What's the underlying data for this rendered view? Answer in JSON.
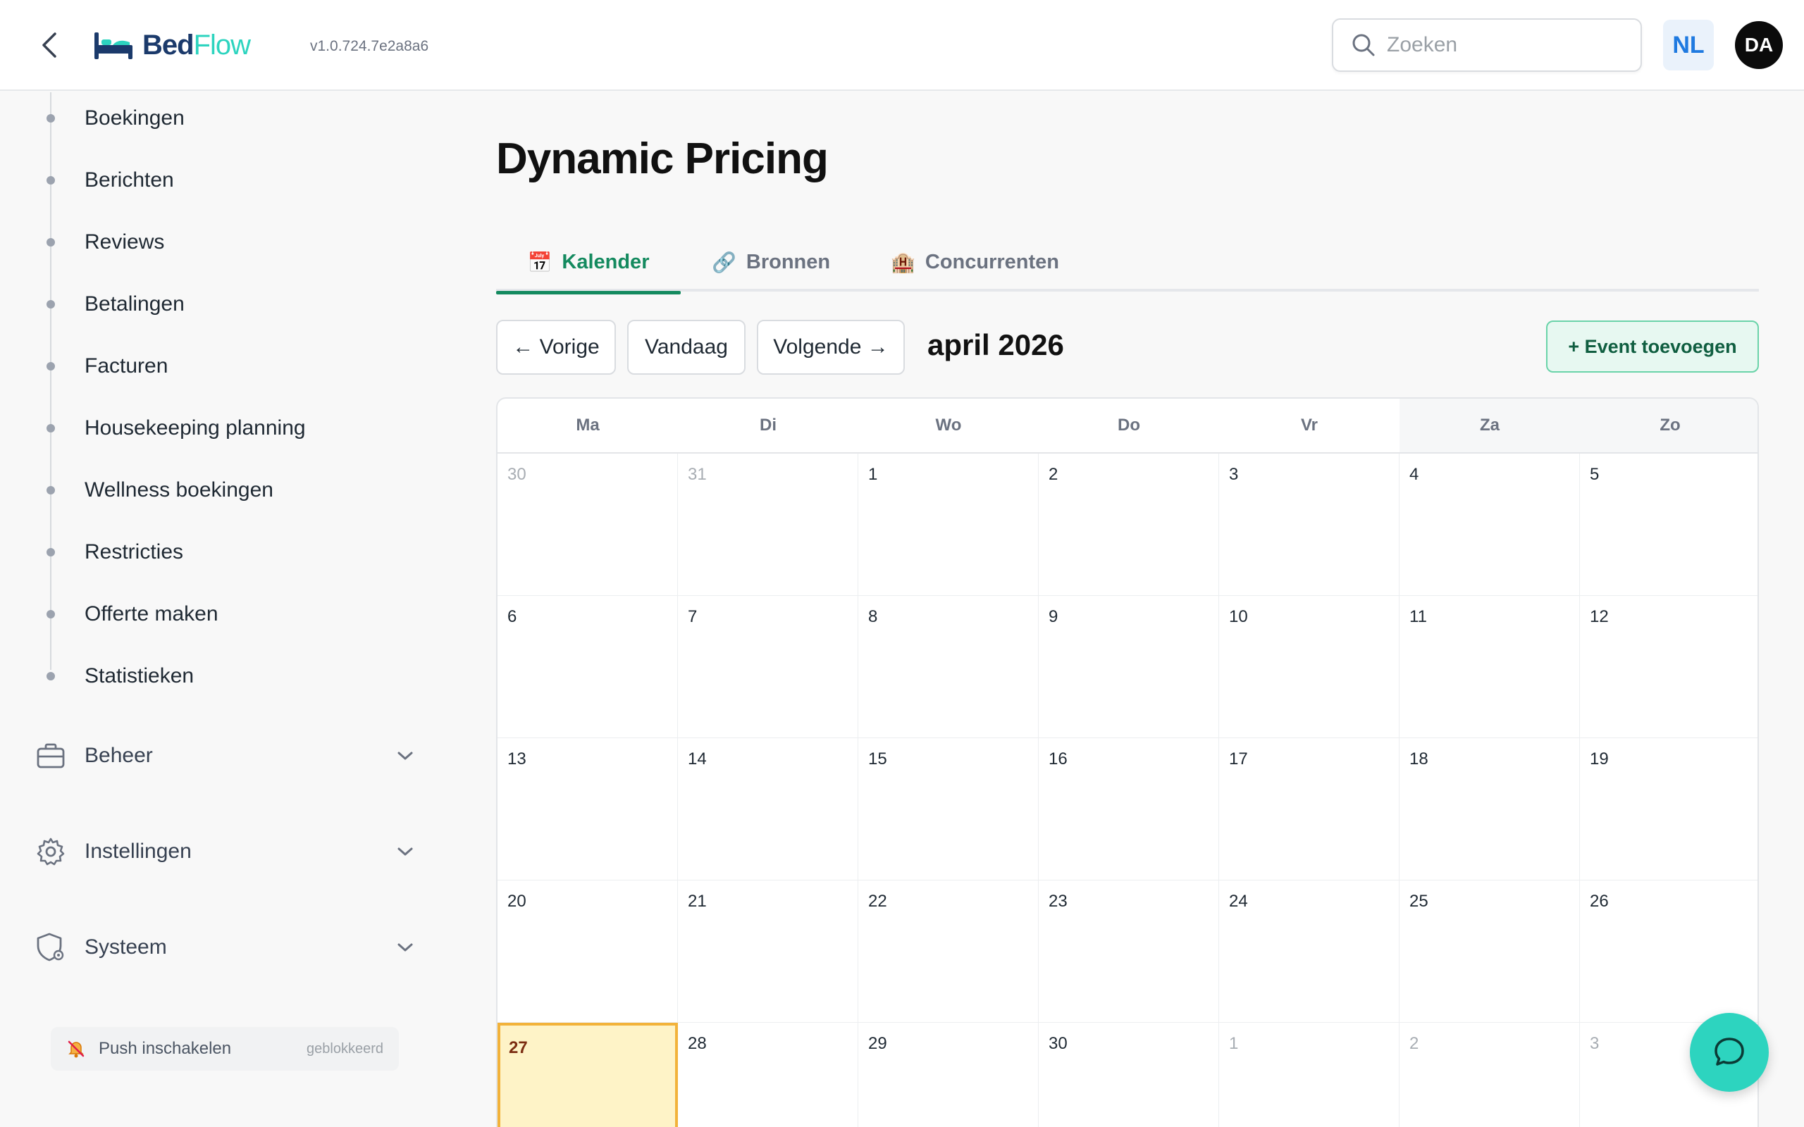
{
  "header": {
    "logo_bed": "Bed",
    "logo_flow": "Flow",
    "version": "v1.0.724.7e2a8a6",
    "search_placeholder": "Zoeken",
    "language": "NL",
    "user_initials": "DA"
  },
  "sidebar": {
    "sub_items": [
      {
        "label": "Boekingen"
      },
      {
        "label": "Berichten"
      },
      {
        "label": "Reviews"
      },
      {
        "label": "Betalingen"
      },
      {
        "label": "Facturen"
      },
      {
        "label": "Housekeeping planning"
      },
      {
        "label": "Wellness boekingen"
      },
      {
        "label": "Restricties"
      },
      {
        "label": "Offerte maken"
      },
      {
        "label": "Statistieken"
      }
    ],
    "groups": [
      {
        "label": "Beheer",
        "icon": "briefcase-icon"
      },
      {
        "label": "Instellingen",
        "icon": "gear-icon"
      },
      {
        "label": "Systeem",
        "icon": "shield-gear-icon"
      }
    ],
    "push": {
      "label": "Push inschakelen",
      "status": "geblokkeerd",
      "icon": "bell-off-icon"
    }
  },
  "main": {
    "title": "Dynamic Pricing",
    "tabs": [
      {
        "label": "Kalender",
        "icon": "📅",
        "active": true
      },
      {
        "label": "Bronnen",
        "icon": "🔗",
        "active": false
      },
      {
        "label": "Concurrenten",
        "icon": "🏨",
        "active": false
      }
    ],
    "toolbar": {
      "prev_label": "← Vorige",
      "today_label": "Vandaag",
      "next_label": "Volgende →",
      "month_label": "april 2026",
      "add_event_label": "+ Event toevoegen"
    },
    "calendar": {
      "weekdays": [
        "Ma",
        "Di",
        "Wo",
        "Do",
        "Vr",
        "Za",
        "Zo"
      ],
      "weeks": [
        [
          {
            "day": "30",
            "out": true
          },
          {
            "day": "31",
            "out": true
          },
          {
            "day": "1"
          },
          {
            "day": "2"
          },
          {
            "day": "3"
          },
          {
            "day": "4"
          },
          {
            "day": "5"
          }
        ],
        [
          {
            "day": "6"
          },
          {
            "day": "7"
          },
          {
            "day": "8"
          },
          {
            "day": "9"
          },
          {
            "day": "10"
          },
          {
            "day": "11"
          },
          {
            "day": "12"
          }
        ],
        [
          {
            "day": "13"
          },
          {
            "day": "14"
          },
          {
            "day": "15"
          },
          {
            "day": "16"
          },
          {
            "day": "17"
          },
          {
            "day": "18"
          },
          {
            "day": "19"
          }
        ],
        [
          {
            "day": "20"
          },
          {
            "day": "21"
          },
          {
            "day": "22"
          },
          {
            "day": "23"
          },
          {
            "day": "24"
          },
          {
            "day": "25"
          },
          {
            "day": "26"
          }
        ],
        [
          {
            "day": "27",
            "today": true
          },
          {
            "day": "28"
          },
          {
            "day": "29"
          },
          {
            "day": "30"
          },
          {
            "day": "1",
            "out": true
          },
          {
            "day": "2",
            "out": true
          },
          {
            "day": "3",
            "out": true
          }
        ]
      ]
    }
  },
  "colors": {
    "accent_green": "#148a5f",
    "brand_teal": "#2dd4bf",
    "brand_navy": "#1b3a6b",
    "today_bg": "#fef3c7",
    "today_border": "#f2b23a"
  }
}
